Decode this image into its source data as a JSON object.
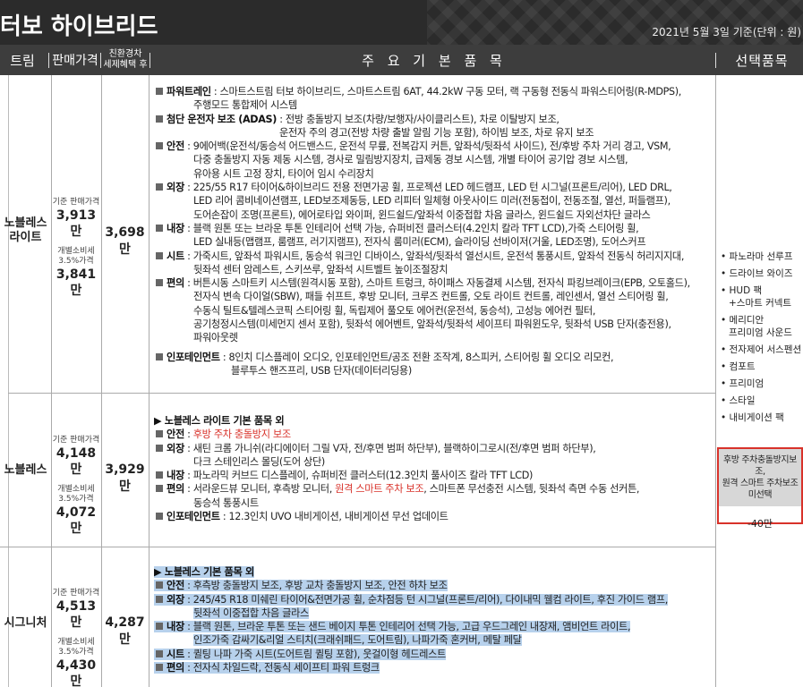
{
  "header": {
    "title": "터보 하이브리드",
    "note": "2021년 5월 3일 기준(단위 : 원)"
  },
  "columns": {
    "trim": "트림",
    "price": "판매가격",
    "eco_line1": "친환경차",
    "eco_line2": "세제혜택 후",
    "main": "주 요 기 본 품 목",
    "options": "선택품목"
  },
  "rows": [
    {
      "trim_line1": "노블레스",
      "trim_line2": "라이트",
      "base_price_label": "기준 판매가격",
      "base_price": "3,913만",
      "indiv_tax_label_line1": "개별소비세",
      "indiv_tax_label_line2": "3.5%가격",
      "indiv_tax_price": "3,841만",
      "eco_price": "3,698만",
      "specs": [
        "파워트레인",
        " : 스마트스트림 터보 하이브리드, 스마트스트림 6AT, 44.2kW 구동 모터, 랙 구동형 전동식 파워스티어링(R-MDPS),",
        "주행모드 통합제어 시스템",
        "첨단 운전자 보조 (ADAS)",
        " : 전방 충돌방지 보조(차량/보행자/사이클리스트), 차로 이탈방지 보조,",
        "운전자 주의 경고(전방 차량 출발 알림 기능 포함), 하이빔 보조, 차로 유지 보조",
        "안전",
        " : 9에어백(운전석/동승석 어드밴스드, 운전석 무릎, 전복감지 커튼, 앞좌석/뒷좌석 사이드), 전/후방 주차 거리 경고, VSM,",
        "다중 충돌방지 자동 제동 시스템, 경사로 밀림방지장치, 급제동 경보 시스템, 개별 타이어 공기압 경보 시스템,",
        "유아용 시트 고정 장치, 타이어 임시 수리장치",
        "외장",
        " : 225/55 R17 타이어&하이브리드 전용 전면가공 휠, 프로젝션 LED 헤드램프, LED 턴 시그널(프론트/리어), LED DRL,",
        "LED 리어 콤비네이션램프, LED보조제동등, LED 리피터 일체형 아웃사이드 미러(전동접이, 전동조절, 열선, 퍼들램프),",
        "도어손잡이 조명(프론트), 에어로타입 와이퍼, 윈드쉴드/앞좌석 이중접합 차음 글라스, 윈드쉴드 자외선차단 글라스",
        "내장",
        " : 블랙 원톤 또는 브라운 투톤 인테리어 선택 가능, 슈퍼비전 클러스터(4.2인치 칼라 TFT LCD),가죽 스티어링 휠,",
        "LED 실내등(맵램프, 룸램프, 러기지램프), 전자식 룸미러(ECM), 슬라이딩 선바이저(거울, LED조명), 도어스커프",
        "시트",
        " : 가죽시트, 앞좌석 파워시트, 동승석 워크인 디바이스, 앞좌석/뒷좌석 열선시트, 운전석 통풍시트, 앞좌석 전동식 허리지지대,",
        "뒷좌석 센터 암레스트, 스키쓰루, 앞좌석 시트벨트 높이조절장치",
        "편의",
        " : 버튼시동 스마트키 시스템(원격시동 포함), 스마트 트렁크, 하이패스 자동결제 시스템, 전자식 파킹브레이크(EPB, 오토홀드),",
        "전자식 변속 다이얼(SBW), 패들 쉬프트, 후방 모니터, 크루즈 컨트롤, 오토 라이트 컨트롤, 레인센서, 열선 스티어링 휠,",
        "수동식 틸트&텔레스코픽 스티어링 휠, 독립제어 풀오토 에어컨(운전석, 동승석), 고성능 에어컨 필터,",
        "공기청정시스템(미세먼지 센서 포함), 뒷좌석 에어벤트, 앞좌석/뒷좌석 세이프티 파워윈도우, 뒷좌석 USB 단자(충전용),",
        "파워아웃렛",
        "인포테인먼트",
        " : 8인치 디스플레이 오디오, 인포테인먼트/공조 전환 조작계, 8스피커, 스티어링 휠 오디오 리모컨,",
        "블루투스 핸즈프리, USB 단자(데이터리딩용)"
      ]
    },
    {
      "trim_line1": "노블레스",
      "base_price_label": "기준 판매가격",
      "base_price": "4,148만",
      "indiv_tax_label_line1": "개별소비세",
      "indiv_tax_label_line2": "3.5%가격",
      "indiv_tax_price": "4,072만",
      "eco_price": "3,929만",
      "specs": [
        "▶ 노블레스 라이트 기본 품목 외",
        "안전",
        " : ",
        "후방 주차 충돌방지 보조",
        "외장",
        " : 새틴 크롬 가니쉬(라디에이터 그릴 V자, 전/후면 범퍼 하단부), 블랙하이그로시(전/후면 범퍼 하단부),",
        "다크 스테인리스 몰딩(도어 상단)",
        "내장",
        " : 파노라믹 커브드 디스플레이, 슈퍼비전 클러스터(12.3인치 풀사이즈 칼라 TFT LCD)",
        "편의",
        " : 서라운드뷰 모니터, 후측방 모니터, ",
        "원격 스마트 주차 보조",
        ", 스마트폰 무선충전 시스템, 뒷좌석 측면 수동 선커튼,",
        "동승석 통풍시트",
        "인포테인먼트",
        " : 12.3인치 UVO 내비게이션, 내비게이션 무선 업데이트"
      ]
    },
    {
      "trim_line1": "시그니처",
      "base_price_label": "기준 판매가격",
      "base_price": "4,513만",
      "indiv_tax_label_line1": "개별소비세",
      "indiv_tax_label_line2": "3.5%가격",
      "indiv_tax_price": "4,430만",
      "eco_price": "4,287만",
      "specs": [
        "▶ 노블레스 기본 품목 외",
        "안전",
        " : 후측방 충돌방지 보조, 후방 교차 충돌방지 보조, 안전 하차 보조",
        "외장",
        " : 245/45 R18 미쉐린 타이어&전면가공 휠, 순차점등 턴 시그널(프론트/리어), 다이내믹 웰컴 라이트, 후진 가이드 램프,",
        "뒷좌석 이중접합 차음 글라스",
        "내장",
        " : 블랙 원톤, 브라운 투톤 또는 샌드 베이지 투톤 인테리어 선택 가능, 고급 우드그레인 내장재, 앰비언트 라이트,",
        "인조가죽 감싸기&리얼 스티치(크래쉬패드, 도어트림), 나파가죽 혼커버, 메탈 페달",
        "시트",
        " : 퀼팅 나파 가죽 시트(도어트림 퀼팅 포함), 웃걸이형 헤드레스트",
        "편의",
        " : 전자식 차일드락, 전동식 세이프티 파워 트렁크"
      ]
    }
  ],
  "options": {
    "items": [
      "파노라마 선루프",
      "드라이브 와이즈",
      "HUD 팩",
      "+스마트 커넥트",
      "메리디안",
      "프리미엄 사운드",
      "전자제어 서스펜션",
      "컴포트",
      "프리미엄",
      "스타일",
      "내비게이션 팩"
    ],
    "box_line1": "후방 주차충돌방지보조,",
    "box_line2": "원격 스마트 주차보조",
    "box_line3": "미선택",
    "box_price": "-40만"
  }
}
